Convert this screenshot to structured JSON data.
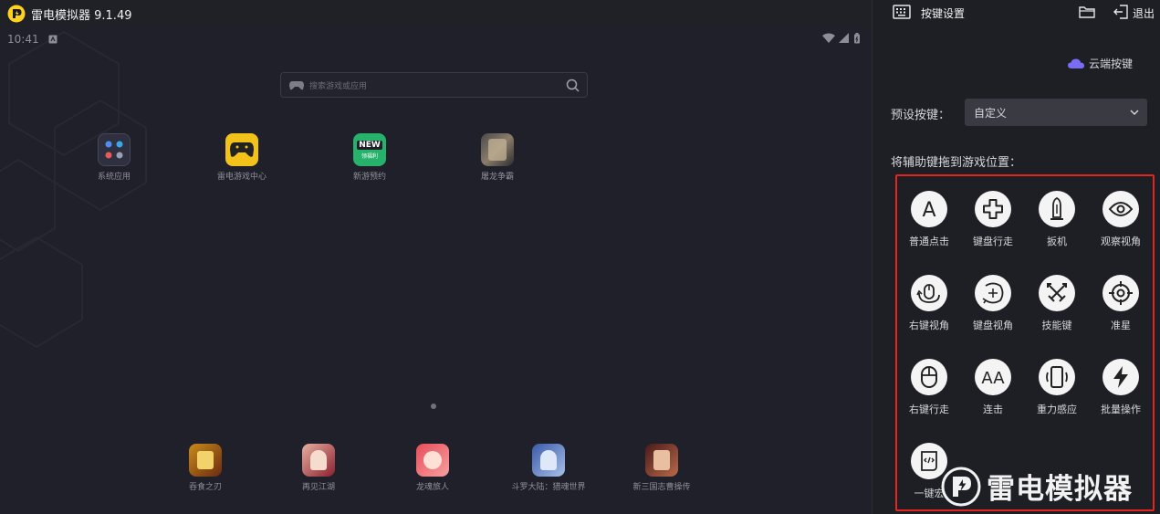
{
  "window": {
    "title": "雷电模拟器 9.1.49"
  },
  "status": {
    "time": "10:41"
  },
  "search": {
    "placeholder": "搜索游戏或应用"
  },
  "apps": [
    {
      "label": "系统应用",
      "icon": "system-apps-icon"
    },
    {
      "label": "雷电游戏中心",
      "icon": "game-center-icon"
    },
    {
      "label": "新游预约",
      "icon": "new-game-icon",
      "badge_top": "NEW",
      "badge_bottom": "领福利"
    },
    {
      "label": "屠龙争霸",
      "icon": "game-icon"
    }
  ],
  "dock": [
    {
      "label": "吞食之刃",
      "icon": "game-icon"
    },
    {
      "label": "再见江湖",
      "icon": "game-icon"
    },
    {
      "label": "龙魂旅人",
      "icon": "game-icon"
    },
    {
      "label": "斗罗大陆：猎魂世界",
      "icon": "game-icon"
    },
    {
      "label": "新三国志曹操传",
      "icon": "game-icon"
    }
  ],
  "sidebar": {
    "title": "按键设置",
    "exit_label": "退出",
    "cloud_label": "云端按键",
    "preset_label": "预设按键：",
    "preset_value": "自定义",
    "drag_label": "将辅助键拖到游戏位置：",
    "keys": [
      {
        "label": "普通点击",
        "icon": "letter-a-icon"
      },
      {
        "label": "键盘行走",
        "icon": "dpad-icon"
      },
      {
        "label": "扳机",
        "icon": "bullet-icon"
      },
      {
        "label": "观察视角",
        "icon": "eye-icon"
      },
      {
        "label": "右键视角",
        "icon": "mouse-rotate-icon"
      },
      {
        "label": "键盘视角",
        "icon": "keyboard-rotate-icon"
      },
      {
        "label": "技能键",
        "icon": "crossed-swords-icon"
      },
      {
        "label": "准星",
        "icon": "crosshair-icon"
      },
      {
        "label": "右键行走",
        "icon": "mouse-icon"
      },
      {
        "label": "连击",
        "icon": "double-a-icon"
      },
      {
        "label": "重力感应",
        "icon": "phone-shake-icon"
      },
      {
        "label": "批量操作",
        "icon": "lightning-icon"
      },
      {
        "label": "一键宏",
        "icon": "macro-icon"
      }
    ]
  },
  "watermark": {
    "text": "雷电模拟器"
  },
  "colors": {
    "accent": "#ffd21f",
    "highlight_border": "#e4241f",
    "cloud": "#7b6cf6"
  }
}
